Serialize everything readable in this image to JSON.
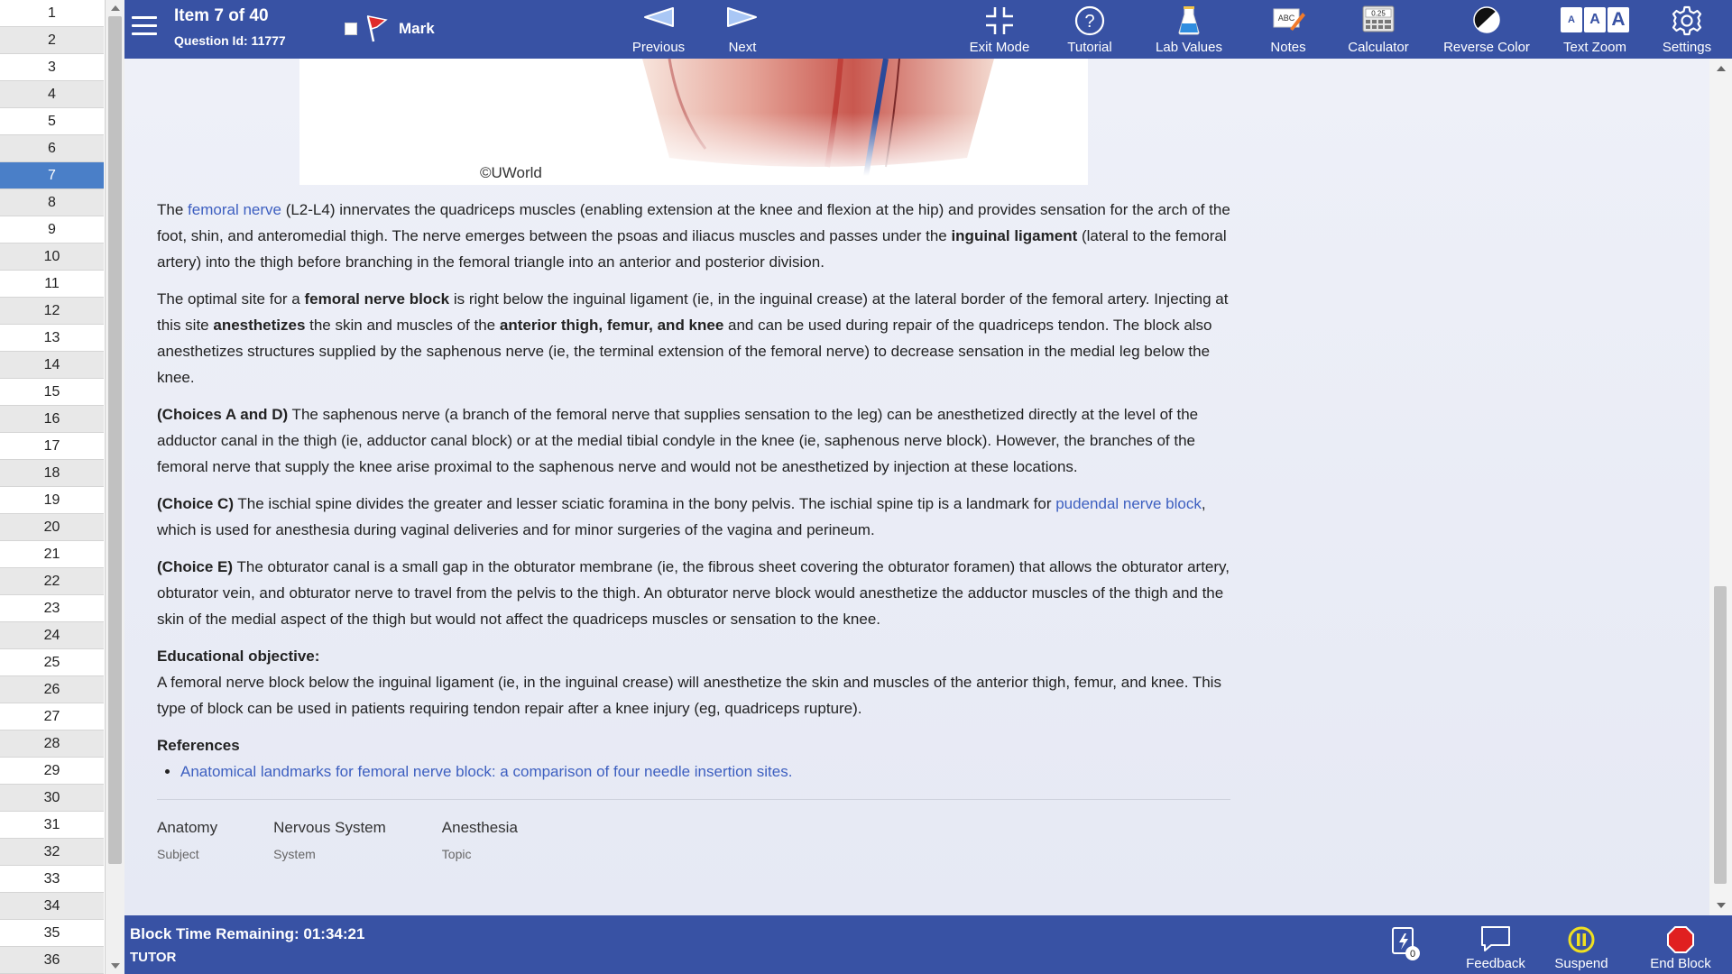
{
  "header": {
    "item_label": "Item 7 of 40",
    "question_id": "Question Id: 11777",
    "mark_label": "Mark",
    "buttons": {
      "previous": "Previous",
      "next": "Next",
      "exit_mode": "Exit Mode",
      "tutorial": "Tutorial",
      "lab_values": "Lab Values",
      "notes": "Notes",
      "calculator": "Calculator",
      "reverse_color": "Reverse Color",
      "text_zoom": "Text Zoom",
      "settings": "Settings"
    },
    "calculator_display": "0.25",
    "notes_icon_text": "ABC",
    "text_zoom_letters": [
      "A",
      "A",
      "A"
    ]
  },
  "question_list": {
    "items": [
      "1",
      "2",
      "3",
      "4",
      "5",
      "6",
      "7",
      "8",
      "9",
      "10",
      "11",
      "12",
      "13",
      "14",
      "15",
      "16",
      "17",
      "18",
      "19",
      "20",
      "21",
      "22",
      "23",
      "24",
      "25",
      "26",
      "27",
      "28",
      "29",
      "30",
      "31",
      "32",
      "33",
      "34",
      "35",
      "36"
    ],
    "active": "7"
  },
  "content": {
    "copyright": "©UWorld",
    "p1": {
      "a": "The ",
      "link": "femoral nerve",
      "b": " (L2-L4) innervates the quadriceps muscles (enabling extension at the knee and flexion at the hip) and provides sensation for the arch of the foot, shin, and anteromedial thigh.  The nerve emerges between the psoas and iliacus muscles and passes under the ",
      "bold": "inguinal ligament",
      "c": " (lateral to the femoral artery) into the thigh before branching in the femoral triangle into an anterior and posterior division."
    },
    "p2": {
      "a": "The optimal site for a ",
      "bold1": "femoral nerve block",
      "b": " is right below the inguinal ligament (ie, in the inguinal crease) at the lateral border of the femoral artery.  Injecting at this site ",
      "bold2": "anesthetizes",
      "c": " the skin and muscles of the ",
      "bold3": "anterior thigh, femur, and knee",
      "d": " and can be used during repair of the quadriceps tendon.  The block also anesthetizes structures supplied by the saphenous nerve (ie, the terminal extension of the femoral nerve) to decrease sensation in the medial leg below the knee."
    },
    "p3": {
      "bold": "(Choices A and D)",
      "text": "  The saphenous nerve (a branch of the femoral nerve that supplies sensation to the leg) can be anesthetized directly at the level of the adductor canal in the thigh (ie, adductor canal block) or at the medial tibial condyle in the knee (ie, saphenous nerve block).  However, the branches of the femoral nerve that supply the knee arise proximal to the saphenous nerve and would not be anesthetized by injection at these locations."
    },
    "p4": {
      "bold": "(Choice C)",
      "a": "  The ischial spine divides the greater and lesser sciatic foramina in the bony pelvis.  The ischial spine tip is a landmark for ",
      "link": "pudendal nerve block",
      "b": ", which is used for anesthesia during vaginal deliveries and for minor surgeries of the vagina and perineum."
    },
    "p5": {
      "bold": "(Choice E)",
      "text": "  The obturator canal is a small gap in the obturator membrane (ie, the fibrous sheet covering the obturator foramen) that allows the obturator artery, obturator vein, and obturator nerve to travel from the pelvis to the thigh.  An obturator nerve block would anesthetize the adductor muscles of the thigh and the skin of the medial aspect of the thigh but would not affect the quadriceps muscles or sensation to the knee."
    },
    "edu_heading": "Educational objective:",
    "edu_text": "A femoral nerve block below the inguinal ligament (ie, in the inguinal crease) will anesthetize the skin and muscles of the anterior thigh, femur, and knee.  This type of block can be used in patients requiring tendon repair after a knee injury (eg, quadriceps rupture).",
    "refs_heading": "References",
    "refs": [
      "Anatomical landmarks for femoral nerve block: a comparison of four needle insertion sites."
    ],
    "tags": [
      {
        "value": "Anatomy",
        "key": "Subject"
      },
      {
        "value": "Nervous System",
        "key": "System"
      },
      {
        "value": "Anesthesia",
        "key": "Topic"
      }
    ]
  },
  "footer": {
    "timer": "Block Time Remaining: 01:34:21",
    "mode": "TUTOR",
    "flash_count": "0",
    "feedback": "Feedback",
    "suspend": "Suspend",
    "end_block": "End Block"
  },
  "colors": {
    "bar": "#3852a4",
    "active_item": "#4a7fc8",
    "link": "#3d5fc0",
    "suspend": "#f0e020",
    "end_block": "#e02020"
  }
}
